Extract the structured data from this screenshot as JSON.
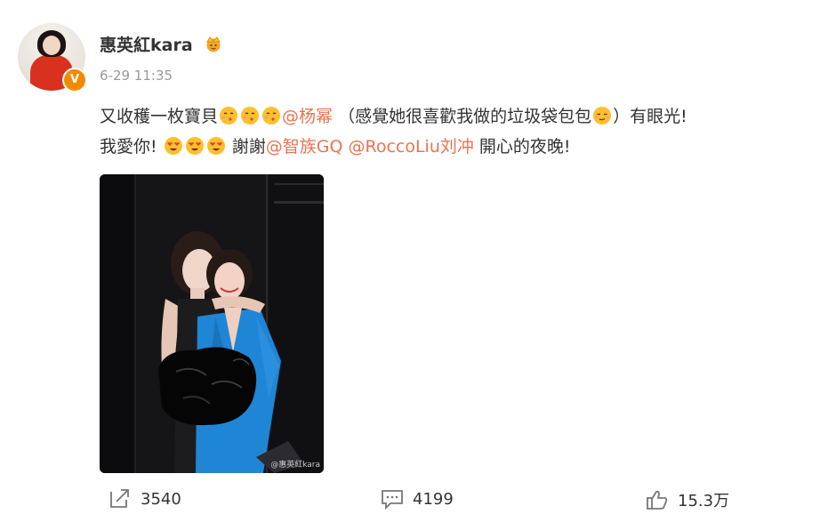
{
  "post": {
    "author": {
      "name": "惠英紅kara",
      "verified_badge": "V",
      "badge_color": "#f28a00"
    },
    "timestamp": "6-29 11:35",
    "content": {
      "line1_text": "又收穫一枚寶貝",
      "mention_1": "@杨幂",
      "line1_paren": "（感覺她很喜歡我做的垃圾袋包包",
      "line1_end": "）有眼光!",
      "line2_text": "我愛你!",
      "line2_thanks": "謝謝",
      "mention_2": "@智族GQ",
      "mention_3": "@RoccoLiu刘冲",
      "line2_end": "開心的夜晚!"
    },
    "image": {
      "watermark": "@惠英紅kara"
    },
    "actions": {
      "repost_count": "3540",
      "comment_count": "4199",
      "like_count": "15.3万"
    },
    "colors": {
      "mention": "#eb7350",
      "text": "#333333",
      "timestamp": "#999999"
    }
  }
}
